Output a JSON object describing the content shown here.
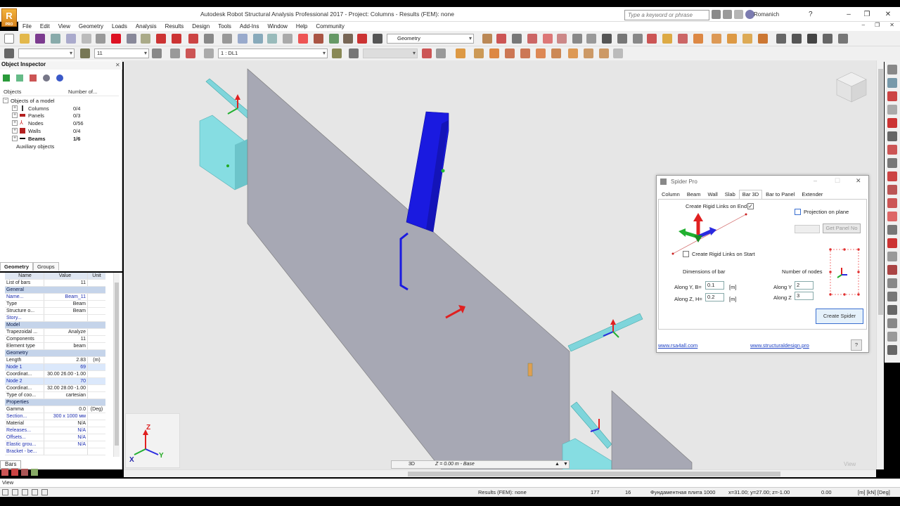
{
  "app": {
    "logo_text": "R",
    "logo_sub": "PRO",
    "title": "Autodesk Robot Structural Analysis Professional 2017 - Project: Columns - Results (FEM): none",
    "search_placeholder": "Type a keyword or phrase",
    "user": "Romanich",
    "help": "?"
  },
  "window_controls": [
    "–",
    "❐",
    "✕"
  ],
  "menu": [
    "File",
    "Edit",
    "View",
    "Geometry",
    "Loads",
    "Analysis",
    "Results",
    "Design",
    "Tools",
    "Add-Ins",
    "Window",
    "Help",
    "Community"
  ],
  "toolbar1": {
    "layout_select": "Geometry"
  },
  "toolbar2": {
    "select1": "",
    "bar_select": "11",
    "case_select": "1 : DL1"
  },
  "inspector": {
    "title": "Object Inspector",
    "col_objects": "Objects",
    "col_number": "Number of...",
    "root": "Objects of a model",
    "items": [
      {
        "label": "Columns",
        "count": "0/4",
        "color": "#3a3a3a"
      },
      {
        "label": "Panels",
        "count": "0/3",
        "color": "#b32020"
      },
      {
        "label": "Nodes",
        "count": "0/56",
        "color": "#cc2222"
      },
      {
        "label": "Walls",
        "count": "0/4",
        "color": "#b32020"
      },
      {
        "label": "Beams",
        "count": "1/6",
        "color": "#111111",
        "bold": true
      }
    ],
    "aux": "Auxiliary objects",
    "tabs": [
      "Geometry",
      "Groups"
    ]
  },
  "properties": {
    "headers": [
      "Name",
      "Value",
      "Unit"
    ],
    "rows": [
      {
        "type": "plain",
        "name": "List of bars",
        "value": "11",
        "unit": ""
      },
      {
        "type": "section",
        "name": "General",
        "value": "",
        "unit": ""
      },
      {
        "type": "blue",
        "name": "Name...",
        "value": "Beam_11",
        "unit": ""
      },
      {
        "type": "plain",
        "name": "Type",
        "value": "Beam",
        "unit": ""
      },
      {
        "type": "plain",
        "name": "Structure o...",
        "value": "Beam",
        "unit": ""
      },
      {
        "type": "blue",
        "name": "Story...",
        "value": "",
        "unit": ""
      },
      {
        "type": "section",
        "name": "Model",
        "value": "",
        "unit": ""
      },
      {
        "type": "plain",
        "name": "Trapezoidal ...",
        "value": "Analyze",
        "unit": ""
      },
      {
        "type": "plain",
        "name": "Components",
        "value": "11",
        "unit": ""
      },
      {
        "type": "plain",
        "name": "Element type",
        "value": "beam",
        "unit": ""
      },
      {
        "type": "section",
        "name": "Geometry",
        "value": "",
        "unit": ""
      },
      {
        "type": "plain",
        "name": "Length",
        "value": "2.83",
        "unit": "(m)"
      },
      {
        "type": "hl",
        "name": "Node 1",
        "value": "69",
        "unit": ""
      },
      {
        "type": "plain",
        "name": "Coordinat...",
        "value": "30.00 26.00 -1.00",
        "unit": ""
      },
      {
        "type": "hl",
        "name": "Node 2",
        "value": "70",
        "unit": ""
      },
      {
        "type": "plain",
        "name": "Coordinat...",
        "value": "32.00 28.00 -1.00",
        "unit": ""
      },
      {
        "type": "plain",
        "name": "Type of coo...",
        "value": "cartesian",
        "unit": ""
      },
      {
        "type": "section",
        "name": "Properties",
        "value": "",
        "unit": ""
      },
      {
        "type": "plain",
        "name": "Gamma",
        "value": "0.0",
        "unit": "(Deg)"
      },
      {
        "type": "blue",
        "name": "Section...",
        "value": "300 x 1000 мм",
        "unit": ""
      },
      {
        "type": "plain",
        "name": "Material",
        "value": "N/A",
        "unit": ""
      },
      {
        "type": "blue",
        "name": "Releases...",
        "value": "N/A",
        "unit": ""
      },
      {
        "type": "blue",
        "name": "Offsets...",
        "value": "N/A",
        "unit": ""
      },
      {
        "type": "blue",
        "name": "Elastic grou...",
        "value": "N/A",
        "unit": ""
      },
      {
        "type": "blue",
        "name": "Bracket - be...",
        "value": "",
        "unit": ""
      }
    ],
    "bars_tab": "Bars"
  },
  "viewport": {
    "mode": "3D",
    "plane": "Z = 0.00 m - Base",
    "axes": {
      "x": "X",
      "y": "Y",
      "z": "Z"
    },
    "watermark": "View"
  },
  "spider": {
    "title": "Spider Pro",
    "tabs": [
      "Column",
      "Beam",
      "Wall",
      "Slab",
      "Bar 3D",
      "Bar to Panel",
      "Extender"
    ],
    "active_tab": "Bar 3D",
    "rigid_end_label": "Create Rigid Links on End",
    "rigid_end_checked": "✓",
    "rigid_start_label": "Create Rigid Links on Start",
    "projection_label": "Projection on plane",
    "get_panel_label": "Get Panel No",
    "dimensions_label": "Dimensions of bar",
    "along_y_label": "Along Y,  B=",
    "along_y_value": "0.1",
    "along_z_label": "Along Z,  H=",
    "along_z_value": "0.2",
    "unit": "[m]",
    "nodes_label": "Number of nodes",
    "nodes_y_label": "Along Y",
    "nodes_y_value": "2",
    "nodes_z_label": "Along Z",
    "nodes_z_value": "3",
    "create_button": "Create Spider",
    "link1": "www.rsa4all.com",
    "link2": "www.structuraldesign.pro",
    "help": "?"
  },
  "view_label": "View",
  "status": {
    "results": "Results (FEM): none",
    "n1": "177",
    "n2": "16",
    "plate": "Фундаментная плита 1000",
    "coords": "x=31.00; y=27.00; z=-1.00",
    "angle": "0.00",
    "units": "[m] [kN] [Deg]"
  }
}
